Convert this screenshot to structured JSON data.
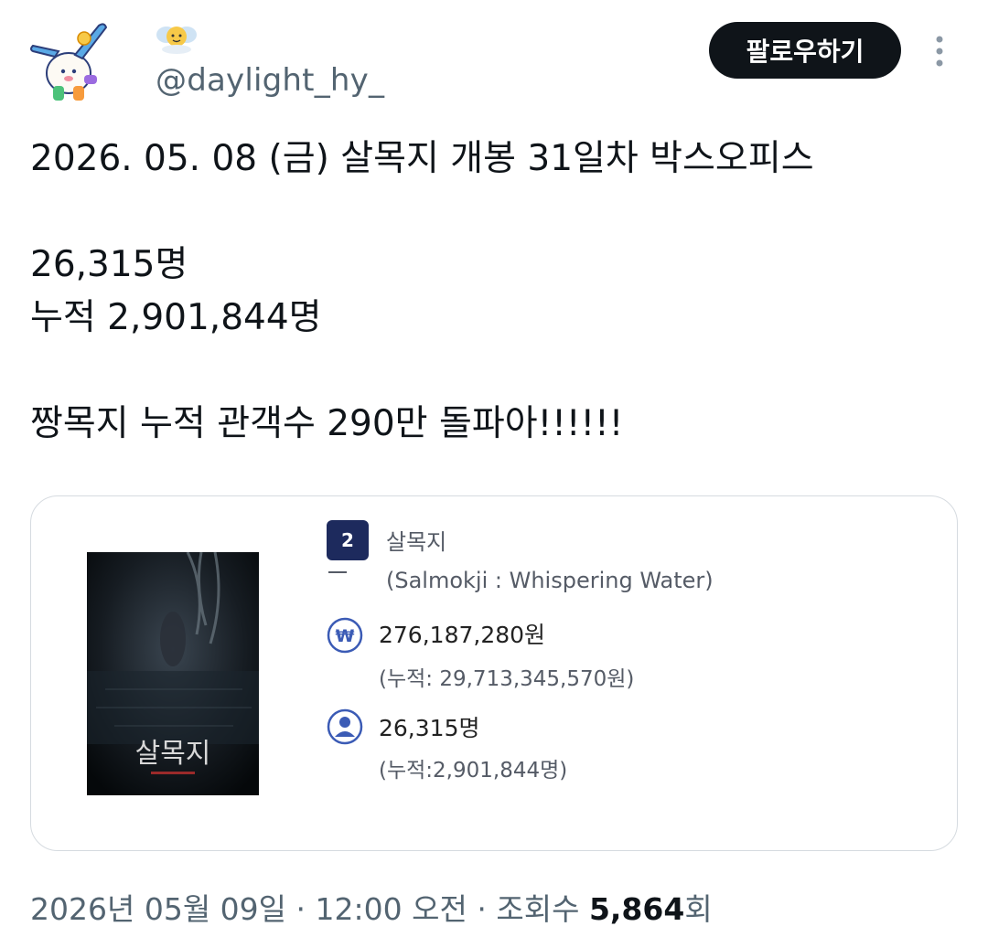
{
  "author": {
    "handle": "@daylight_hy_"
  },
  "follow_button": {
    "label": "팔로우하기"
  },
  "tweet": {
    "text": "2026. 05. 08 (금) 살목지 개봉 31일차 박스오피스\n\n26,315명\n누적 2,901,844명\n\n짱목지 누적 관객수 290만 돌파아!!!!!!"
  },
  "card": {
    "poster_title": "살목지",
    "rank": "2",
    "title": "살목지",
    "subtitle": "(Salmokji : Whispering Water)",
    "sales": "276,187,280원",
    "sales_accumulated": "(누적: 29,713,345,570원)",
    "audience": "26,315명",
    "audience_accumulated": "(누적:2,901,844명)"
  },
  "meta": {
    "date": "2026년 05월 09일",
    "separator": "·",
    "time": "12:00 오전",
    "views_label": "조회수",
    "views_count": "5,864",
    "views_suffix": "회"
  },
  "colors": {
    "follow_bg": "#0f1419",
    "rank_badge": "#1d2a5d",
    "icon_blue": "#3b5bb5",
    "secondary_text": "#536471"
  },
  "icons": [
    "more-dots-icon",
    "won-icon",
    "person-icon",
    "sun-emoji-icon"
  ]
}
